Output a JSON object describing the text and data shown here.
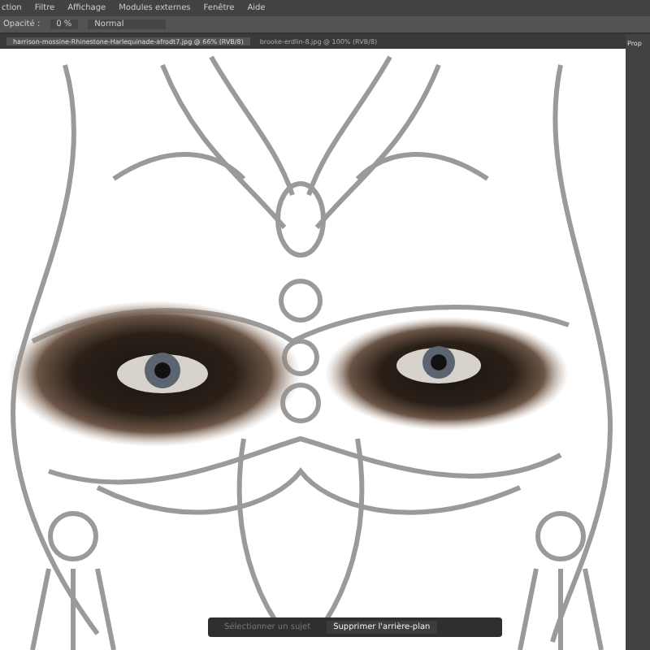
{
  "menu": [
    "ction",
    "Filtre",
    "Affichage",
    "Modules externes",
    "Fenêtre",
    "Aide"
  ],
  "options_bar": {
    "opacity_label": "Opacité :",
    "opacity_value": "0 %",
    "mode": "Normal"
  },
  "tabs": [
    {
      "label": "harrison-mossine-Rhinestone-Harlequinade-afrodt7.jpg @ 66% (RVB/8)",
      "selected": true
    },
    {
      "label": "brooke-erdlin-8.jpg @ 100% (RVB/8)",
      "selected": false
    }
  ],
  "panel": {
    "title": "Prop"
  },
  "contextual_bar": [
    {
      "label": "Sélectionner un sujet",
      "disabled": true
    },
    {
      "label": "Supprimer l'arrière-plan",
      "disabled": false
    }
  ]
}
